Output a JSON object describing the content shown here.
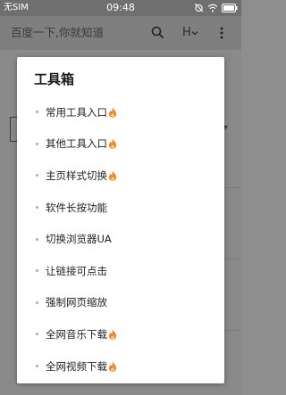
{
  "status_bar": {
    "carrier": "无SIM",
    "time": "09:48"
  },
  "header": {
    "search_hint": "百度一下,你就知道",
    "h_button_label": "H"
  },
  "dialog": {
    "title": "工具箱",
    "items": [
      {
        "label": "常用工具入口",
        "hot": true
      },
      {
        "label": "其他工具入口",
        "hot": true
      },
      {
        "label": "主页样式切换",
        "hot": true
      },
      {
        "label": "软件长按功能",
        "hot": false
      },
      {
        "label": "切换浏览器UA",
        "hot": false
      },
      {
        "label": "让链接可点击",
        "hot": false
      },
      {
        "label": "强制网页缩放",
        "hot": false
      },
      {
        "label": "全网音乐下载",
        "hot": true
      },
      {
        "label": "全网视频下载",
        "hot": true
      }
    ]
  },
  "icons": {
    "status": [
      "alarm-off-icon",
      "wifi-icon",
      "battery-icon"
    ],
    "header": [
      "search-icon",
      "chevron-down-icon",
      "more-vertical-icon"
    ],
    "menu_bullet": "dot-icon",
    "hot_badge": "fire-icon"
  },
  "colors": {
    "overlay": "#8e8e8e",
    "dialog_bg": "#ffffff",
    "bullet": "#c8a77a",
    "fire": "#f0802a"
  }
}
